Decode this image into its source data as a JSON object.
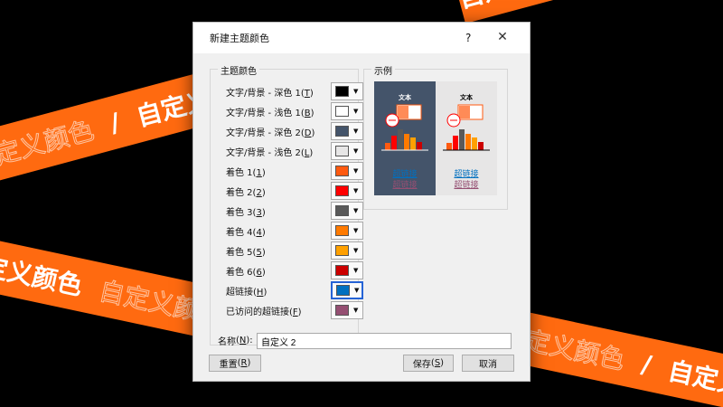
{
  "background": {
    "banner_text": "自定义颜色",
    "separator": "/",
    "band_color": "#ff6a10"
  },
  "dialog": {
    "title": "新建主题颜色",
    "help": "?",
    "close": "✕"
  },
  "theme_colors": {
    "legend": "主题颜色",
    "rows": [
      {
        "label": "文字/背景 - 深色 1",
        "key": "T",
        "swatch": "#000000"
      },
      {
        "label": "文字/背景 - 浅色 1",
        "key": "B",
        "swatch": "#ffffff"
      },
      {
        "label": "文字/背景 - 深色 2",
        "key": "D",
        "swatch": "#44546a"
      },
      {
        "label": "文字/背景 - 浅色 2",
        "key": "L",
        "swatch": "#e7e6e6"
      },
      {
        "label": "着色 1",
        "key": "1",
        "swatch": "#ff5a10"
      },
      {
        "label": "着色 2",
        "key": "2",
        "swatch": "#ff0000"
      },
      {
        "label": "着色 3",
        "key": "3",
        "swatch": "#595959"
      },
      {
        "label": "着色 4",
        "key": "4",
        "swatch": "#ff7a00"
      },
      {
        "label": "着色 5",
        "key": "5",
        "swatch": "#ffa000"
      },
      {
        "label": "着色 6",
        "key": "6",
        "swatch": "#cc0000"
      },
      {
        "label": "超链接",
        "key": "H",
        "swatch": "#0070c0"
      },
      {
        "label": "已访问的超链接",
        "key": "F",
        "swatch": "#954f72"
      }
    ]
  },
  "sample": {
    "legend": "示例",
    "text_label": "文本",
    "link_label": "超链接",
    "visited_label": "超链接"
  },
  "name": {
    "label": "名称",
    "key": "N",
    "value": "自定义 2"
  },
  "buttons": {
    "reset": "重置",
    "reset_key": "R",
    "save": "保存",
    "save_key": "S",
    "cancel": "取消"
  }
}
